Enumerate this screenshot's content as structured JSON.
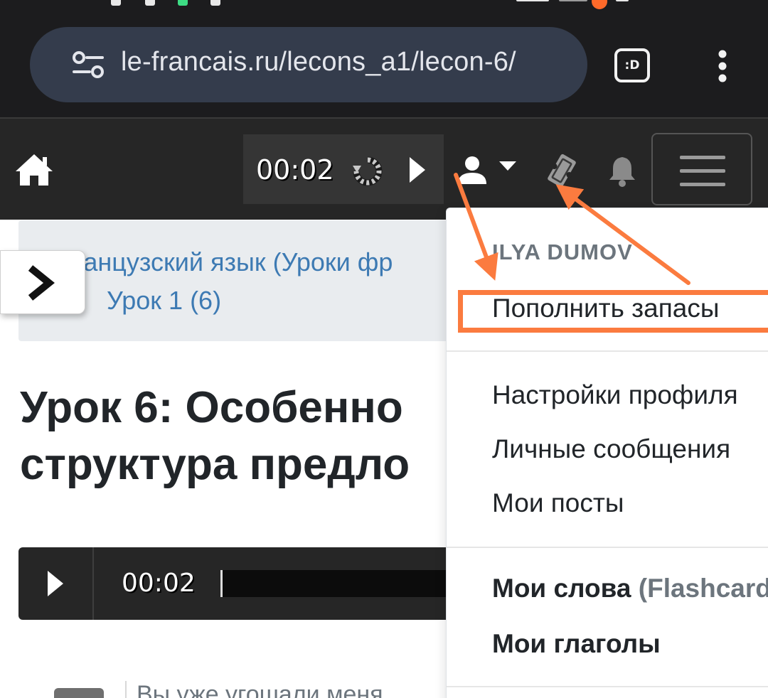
{
  "browser": {
    "url": "le-francais.ru/lecons_a1/lecon-6/",
    "extension_label": ":D"
  },
  "navbar": {
    "timer": "00:02"
  },
  "breadcrumb": {
    "parent": "Французский язык (Уроки фр",
    "separator": ">",
    "current": "Урок 1 (6)"
  },
  "page": {
    "title_line1": "Урок 6: Особенно",
    "title_line2": "структура предло",
    "audio_time": "00:02",
    "comment_preview": "Вы уже угошали меня"
  },
  "user_menu": {
    "username": "ILYA DUMOV",
    "items": [
      {
        "label": "Пополнить запасы"
      },
      {
        "label": "Настройки профиля"
      },
      {
        "label": "Личные сообщения"
      },
      {
        "label": "Мои посты"
      }
    ],
    "flashcards_label": "Мои слова",
    "flashcards_suffix": "(Flashcard",
    "verbs_label": "Мои глаголы"
  },
  "colors": {
    "chrome_bg": "#1c1c1e",
    "navbar_bg": "#262626",
    "link_blue": "#3d7ab3",
    "annotation_orange": "#fb7b3f"
  }
}
